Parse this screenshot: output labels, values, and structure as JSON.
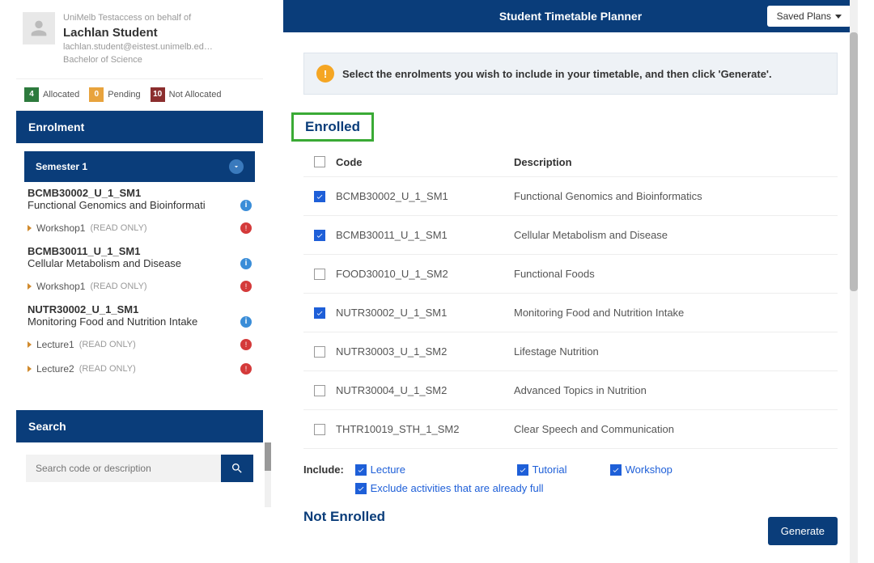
{
  "profile": {
    "behalf": "UniMelb Testaccess on behalf of",
    "name": "Lachlan Student",
    "email": "lachlan.student@eistest.unimelb.ed…",
    "degree": "Bachelor of Science"
  },
  "status": {
    "allocated": {
      "count": "4",
      "label": "Allocated"
    },
    "pending": {
      "count": "0",
      "label": "Pending"
    },
    "not_allocated": {
      "count": "10",
      "label": "Not Allocated"
    }
  },
  "sections": {
    "enrolment": "Enrolment",
    "semester1": "Semester 1",
    "search": "Search"
  },
  "enrolments": {
    "item1": {
      "code": "BCMB30002_U_1_SM1",
      "desc": "Functional Genomics and Bioinformati"
    },
    "item1_act1": {
      "name": "Workshop1",
      "ro": "(READ ONLY)"
    },
    "item2": {
      "code": "BCMB30011_U_1_SM1",
      "desc": "Cellular Metabolism and Disease"
    },
    "item2_act1": {
      "name": "Workshop1",
      "ro": "(READ ONLY)"
    },
    "item3": {
      "code": "NUTR30002_U_1_SM1",
      "desc": "Monitoring Food and Nutrition Intake"
    },
    "item3_act1": {
      "name": "Lecture1",
      "ro": "(READ ONLY)"
    },
    "item3_act2": {
      "name": "Lecture2",
      "ro": "(READ ONLY)"
    }
  },
  "search": {
    "placeholder": "Search code or description"
  },
  "topbar": {
    "title": "Student Timetable Planner",
    "saved_plans": "Saved Plans"
  },
  "alert": {
    "text": "Select the enrolments you wish to include in your timetable, and then click 'Generate'."
  },
  "enrolled_heading": "Enrolled",
  "table": {
    "head": {
      "code": "Code",
      "desc": "Description"
    },
    "rows": [
      {
        "checked": true,
        "code": "BCMB30002_U_1_SM1",
        "desc": "Functional Genomics and Bioinformatics"
      },
      {
        "checked": true,
        "code": "BCMB30011_U_1_SM1",
        "desc": "Cellular Metabolism and Disease"
      },
      {
        "checked": false,
        "code": "FOOD30010_U_1_SM2",
        "desc": "Functional Foods"
      },
      {
        "checked": true,
        "code": "NUTR30002_U_1_SM1",
        "desc": "Monitoring Food and Nutrition Intake"
      },
      {
        "checked": false,
        "code": "NUTR30003_U_1_SM2",
        "desc": "Lifestage Nutrition"
      },
      {
        "checked": false,
        "code": "NUTR30004_U_1_SM2",
        "desc": "Advanced Topics in Nutrition"
      },
      {
        "checked": false,
        "code": "THTR10019_STH_1_SM2",
        "desc": "Clear Speech and Communication"
      }
    ]
  },
  "include": {
    "label": "Include:",
    "lecture": "Lecture",
    "tutorial": "Tutorial",
    "workshop": "Workshop",
    "exclude_full": "Exclude activities that are already full"
  },
  "generate": "Generate",
  "not_enrolled": "Not Enrolled"
}
